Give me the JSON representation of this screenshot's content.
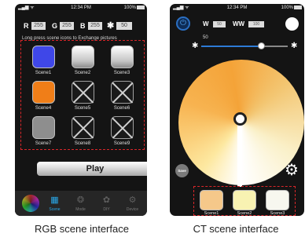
{
  "rgb_screen": {
    "status": {
      "time": "12:34 PM",
      "battery": "100%"
    },
    "rgb_values": {
      "r_label": "R",
      "r_value": "255",
      "g_label": "G",
      "g_value": "255",
      "b_label": "B",
      "b_value": "255",
      "w_symbol": "✱",
      "w_value": "50"
    },
    "hint": "Long press scene icons to Exchange pictures",
    "scenes": [
      {
        "label": "Scene1",
        "color": "#3f47e8"
      },
      {
        "label": "Scene2",
        "color": "silver"
      },
      {
        "label": "Scene3",
        "color": "silver"
      },
      {
        "label": "Scene4",
        "color": "#f07e18"
      },
      {
        "label": "Scene5",
        "color": "empty"
      },
      {
        "label": "Scene6",
        "color": "empty"
      },
      {
        "label": "Scene7",
        "color": "#8e8e8e"
      },
      {
        "label": "Scene8",
        "color": "empty"
      },
      {
        "label": "Scene9",
        "color": "empty"
      }
    ],
    "play_label": "Play",
    "tabs": [
      {
        "label": "Scene",
        "icon": "grid-icon"
      },
      {
        "label": "Mode",
        "icon": "film-reel-icon"
      },
      {
        "label": "DIY",
        "icon": "palette-icon"
      },
      {
        "label": "Device",
        "icon": "gear-icon"
      }
    ]
  },
  "ct_screen": {
    "status": {
      "time": "12:34 PM",
      "battery": "100%"
    },
    "w_label": "W",
    "w_value": "50",
    "ww_label": "WW",
    "ww_value": "100",
    "slider_value": "50",
    "save_label": "Save",
    "scenes": [
      {
        "label": "Scene1",
        "color": "#f5c88a"
      },
      {
        "label": "Scene2",
        "color": "#f8f2b2"
      },
      {
        "label": "Scene3",
        "color": "#f7f7ef"
      }
    ]
  },
  "captions": {
    "left": "RGB scene interface",
    "right": "CT scene interface"
  },
  "colors": {
    "accent_blue": "#29a8e8",
    "dashed_border": "#d9262a"
  }
}
